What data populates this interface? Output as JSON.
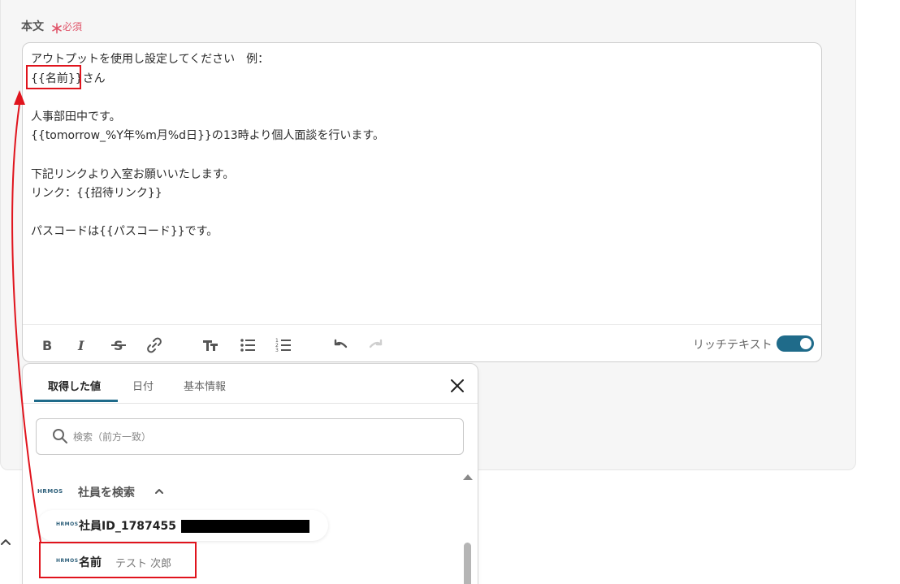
{
  "field": {
    "label": "本文",
    "required_mark": "＊",
    "required_text": "必須"
  },
  "editor": {
    "lines": [
      "アウトプットを使用し設定してください　例：",
      "{{名前}}さん",
      "",
      "人事部田中です。",
      "{{tomorrow_%Y年%m月%d日}}の13時より個人面談を行います。",
      "",
      "下記リンクより入室お願いいたします。",
      "リンク：{{招待リンク}}",
      "",
      "パスコードは{{パスコード}}です。"
    ],
    "toolbar": {
      "bold": "bold-icon",
      "italic": "italic-icon",
      "strike": "strikethrough-icon",
      "link": "link-icon",
      "text_size": "text-size-icon",
      "bullet_list": "bullet-list-icon",
      "numbered_list": "numbered-list-icon",
      "undo": "undo-icon",
      "redo": "redo-icon"
    },
    "rich_text_label": "リッチテキスト",
    "rich_text_enabled": true
  },
  "picker": {
    "tabs": [
      {
        "label": "取得した値",
        "active": true
      },
      {
        "label": "日付",
        "active": false
      },
      {
        "label": "基本情報",
        "active": false
      }
    ],
    "search_placeholder": "検索（前方一致）",
    "logo_text": "HRMOS",
    "group": {
      "title": "社員を検索",
      "expanded": true
    },
    "items": [
      {
        "key": "社員ID_1787455",
        "value": ""
      },
      {
        "key": "名前",
        "value": "テスト 次郎"
      }
    ]
  },
  "colors": {
    "accent": "#1f6b8a",
    "required": "#e0566b",
    "annotation": "#e0141d"
  }
}
